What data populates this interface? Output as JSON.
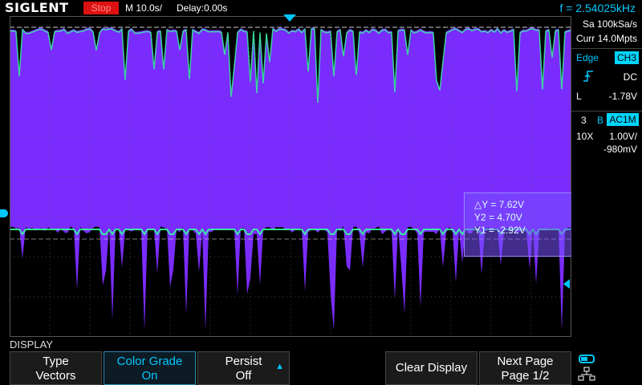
{
  "header": {
    "brand": "SIGLENT",
    "run_state": "Stop",
    "timebase": "M 10.0s/",
    "delay": "Delay:0.00s",
    "frequency": "f = 2.54025kHz"
  },
  "panel": {
    "sample_rate": "Sa 100kSa/s",
    "memory": "Curr 14.0Mpts",
    "trigger": {
      "type": "Edge",
      "source": "CH3",
      "coupling": "DC",
      "level_label": "L",
      "level": "-1.78V"
    },
    "channel": {
      "number": "3",
      "bw_badge": "B",
      "coupling": "AC1M",
      "probe": "10X",
      "scale": "1.00V/",
      "offset": "-980mV"
    }
  },
  "cursors": {
    "delta": "△Y = 7.62V",
    "y2": "Y2 = 4.70V",
    "y1": "Y1 = -2.92V"
  },
  "menu": {
    "title": "DISPLAY",
    "softkeys": [
      {
        "line1": "Type",
        "line2": "Vectors"
      },
      {
        "line1": "Color Grade",
        "line2": "On"
      },
      {
        "line1": "Persist",
        "line2": "Off"
      },
      {
        "line1": "Clear Display",
        "line2": ""
      },
      {
        "line1": "Next Page",
        "line2": "Page 1/2"
      }
    ]
  },
  "colors": {
    "accent": "#00c8ff",
    "trace": "#7a2cff",
    "trace_edge": "#33ff99",
    "stop": "#dd1111"
  }
}
